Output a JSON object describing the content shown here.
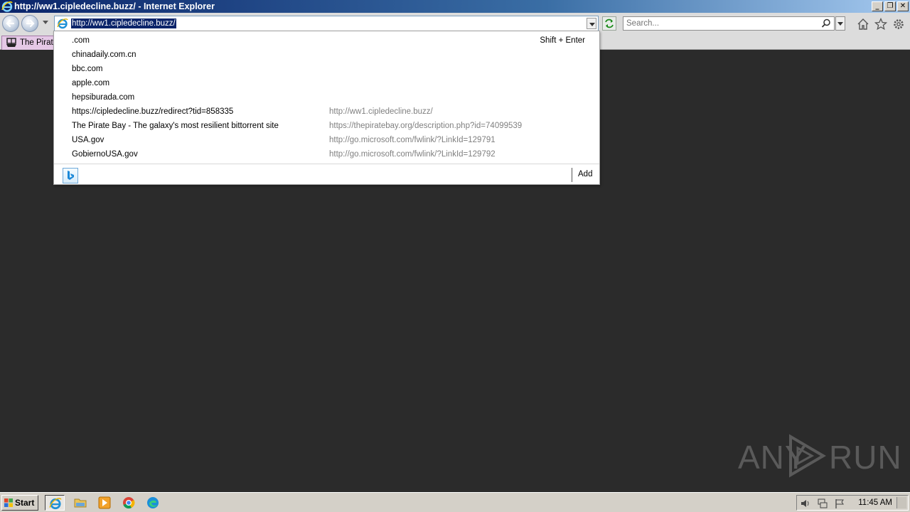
{
  "window": {
    "title": "http://ww1.cipledecline.buzz/ - Internet Explorer",
    "min_label": "_",
    "max_label": "❐",
    "close_label": "✕"
  },
  "toolbar": {
    "address": "http://ww1.cipledecline.buzz/",
    "search_placeholder": "Search..."
  },
  "tab": {
    "label": "The Pirate"
  },
  "dropdown": {
    "shortcut_item": {
      "label": ".com",
      "hint": "Shift + Enter"
    },
    "items": [
      {
        "label": "chinadaily.com.cn",
        "url": ""
      },
      {
        "label": "bbc.com",
        "url": ""
      },
      {
        "label": "apple.com",
        "url": ""
      },
      {
        "label": "hepsiburada.com",
        "url": ""
      },
      {
        "label": "https://cipledecline.buzz/redirect?tid=858335",
        "url": "http://ww1.cipledecline.buzz/"
      },
      {
        "label": "The Pirate Bay - The galaxy's most resilient bittorrent site",
        "url": "https://thepiratebay.org/description.php?id=74099539"
      },
      {
        "label": "USA.gov",
        "url": "http://go.microsoft.com/fwlink/?LinkId=129791"
      },
      {
        "label": "GobiernoUSA.gov",
        "url": "http://go.microsoft.com/fwlink/?LinkId=129792"
      }
    ],
    "add_label": "Add"
  },
  "watermark": {
    "left": "ANY",
    "right": "RUN"
  },
  "taskbar": {
    "start_label": "Start",
    "clock": "11:45 AM"
  },
  "colors": {
    "titlebar": "#0a246a",
    "selection": "#0a246a",
    "tab": "#e5c8e6",
    "desktop": "#2b2b2b"
  }
}
